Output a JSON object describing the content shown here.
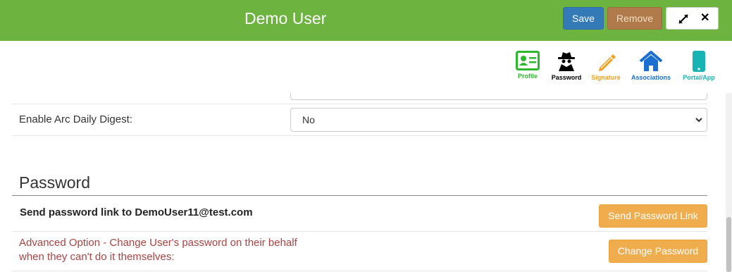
{
  "header": {
    "title": "Demo User",
    "save_label": "Save",
    "remove_label": "Remove",
    "expand_icon": "expand-icon",
    "close_label": "✕"
  },
  "toolbar": {
    "items": [
      {
        "label": "Profile",
        "icon": "profile-card-icon",
        "color": "#2eb82e"
      },
      {
        "label": "Password",
        "icon": "spy-icon",
        "color": "#000000"
      },
      {
        "label": "Signature",
        "icon": "pencil-icon",
        "color": "#f0a020"
      },
      {
        "label": "Associations",
        "icon": "home-icon",
        "color": "#1a6fd1"
      },
      {
        "label": "Portal/App",
        "icon": "mobile-phone-icon",
        "color": "#18b3b3"
      }
    ]
  },
  "settings": {
    "digest_label": "Enable Arc Daily Digest:",
    "digest_value": "No"
  },
  "password": {
    "section_title": "Password",
    "send_label": "Send password link to DemoUser11@test.com",
    "send_button": "Send Password Link",
    "advanced_label": "Advanced Option - Change User's password on their behalf when they can't do it themselves:",
    "change_button": "Change Password"
  },
  "colors": {
    "header_bg": "#6db33f",
    "save_bg": "#337ab7",
    "remove_bg": "#b07a4a",
    "orange_btn": "#f0ad4e",
    "advanced_text": "#a94442"
  }
}
